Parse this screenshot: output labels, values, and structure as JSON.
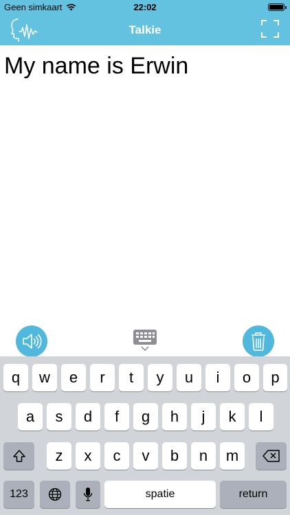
{
  "status_bar": {
    "carrier": "Geen simkaart",
    "time": "22:02"
  },
  "nav": {
    "title": "Talkie"
  },
  "text_area": {
    "text": "My name is Erwin"
  },
  "accessory_bar": {
    "speak_icon": "speaker-icon",
    "keyboard_icon": "keyboard-dismiss-icon",
    "delete_icon": "trash-icon"
  },
  "keyboard": {
    "row1": [
      "q",
      "w",
      "e",
      "r",
      "t",
      "y",
      "u",
      "i",
      "o",
      "p"
    ],
    "row2": [
      "a",
      "s",
      "d",
      "f",
      "g",
      "h",
      "j",
      "k",
      "l"
    ],
    "row3": [
      "z",
      "x",
      "c",
      "v",
      "b",
      "n",
      "m"
    ],
    "numbers_label": "123",
    "space_label": "spatie",
    "return_label": "return"
  },
  "colors": {
    "accent": "#62c2e0",
    "button": "#4fb8dc",
    "keyboard_bg": "#d1d4d9",
    "key_dark": "#abb0ba"
  }
}
